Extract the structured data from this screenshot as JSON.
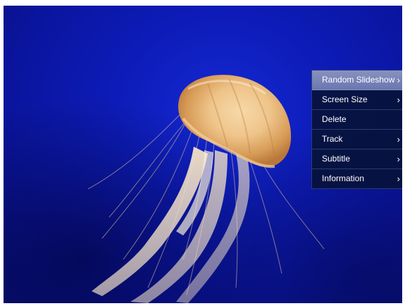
{
  "viewer": {
    "image_subject": "jellyfish",
    "background_color": "#0d1cb8"
  },
  "context_menu": {
    "items": [
      {
        "label": "Random Slideshow",
        "has_submenu": true,
        "selected": true,
        "icon": "chevron-right-icon"
      },
      {
        "label": "Screen Size",
        "has_submenu": true,
        "selected": false,
        "icon": "chevron-right-icon"
      },
      {
        "label": "Delete",
        "has_submenu": false,
        "selected": false
      },
      {
        "label": "Track",
        "has_submenu": true,
        "selected": false,
        "icon": "chevron-right-icon"
      },
      {
        "label": "Subtitle",
        "has_submenu": true,
        "selected": false,
        "icon": "chevron-right-icon"
      },
      {
        "label": "Information",
        "has_submenu": true,
        "selected": false,
        "icon": "chevron-right-icon"
      }
    ],
    "submenu_glyph": "›"
  }
}
